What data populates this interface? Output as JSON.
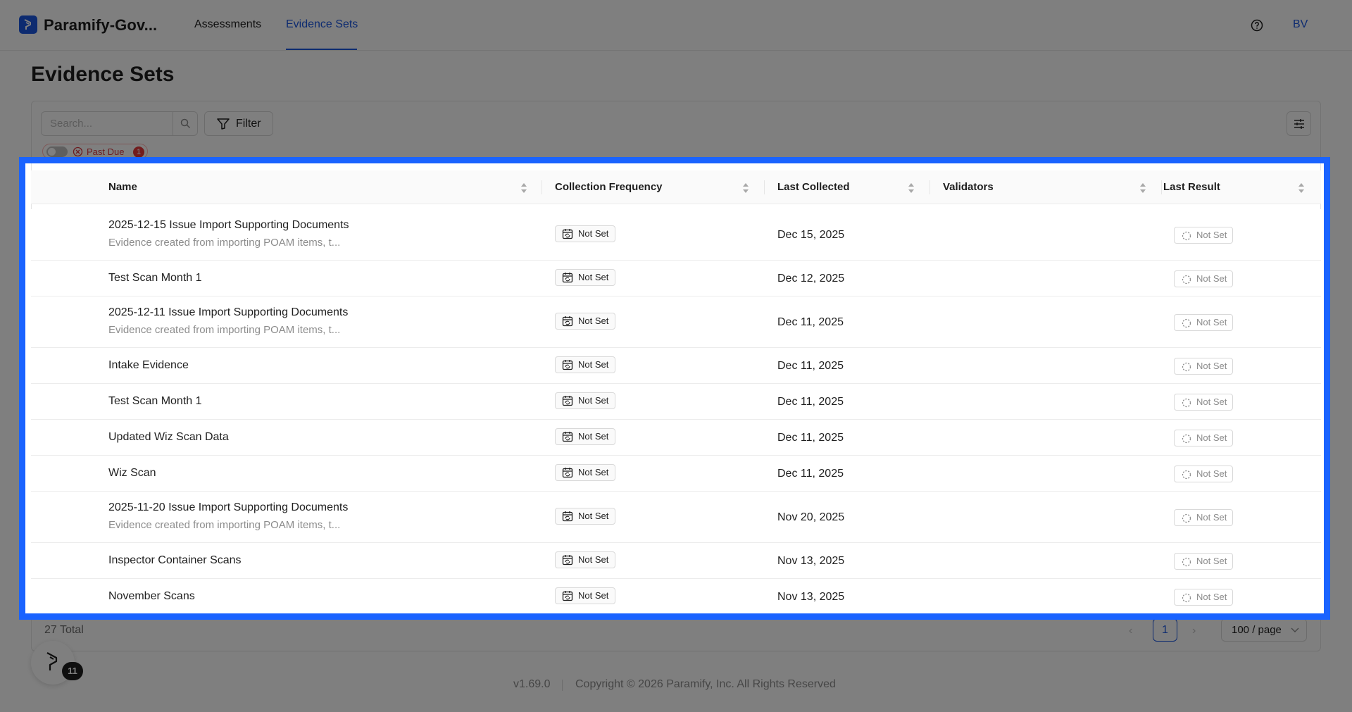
{
  "header": {
    "app_title": "Paramify-Gov...",
    "nav": [
      {
        "label": "Assessments"
      },
      {
        "label": "Evidence Sets"
      }
    ],
    "avatar": "BV"
  },
  "page": {
    "title": "Evidence Sets"
  },
  "toolbar": {
    "search_placeholder": "Search...",
    "filter_label": "Filter",
    "past_due_label": "Past Due",
    "past_due_count": "1"
  },
  "table": {
    "columns": [
      "Name",
      "Collection Frequency",
      "Last Collected",
      "Validators",
      "Last Result"
    ],
    "rows": [
      {
        "name": "2025-12-15 Issue Import Supporting Documents",
        "desc": "Evidence created from importing POAM items, t...",
        "freq": "Not Set",
        "date": "Dec 15, 2025",
        "result": "Not Set"
      },
      {
        "name": "Test Scan Month 1",
        "desc": "",
        "freq": "Not Set",
        "date": "Dec 12, 2025",
        "result": "Not Set"
      },
      {
        "name": "2025-12-11 Issue Import Supporting Documents",
        "desc": "Evidence created from importing POAM items, t...",
        "freq": "Not Set",
        "date": "Dec 11, 2025",
        "result": "Not Set"
      },
      {
        "name": "Intake Evidence",
        "desc": "",
        "freq": "Not Set",
        "date": "Dec 11, 2025",
        "result": "Not Set"
      },
      {
        "name": "Test Scan Month 1",
        "desc": "",
        "freq": "Not Set",
        "date": "Dec 11, 2025",
        "result": "Not Set"
      },
      {
        "name": "Updated Wiz Scan Data",
        "desc": "",
        "freq": "Not Set",
        "date": "Dec 11, 2025",
        "result": "Not Set"
      },
      {
        "name": "Wiz Scan",
        "desc": "",
        "freq": "Not Set",
        "date": "Dec 11, 2025",
        "result": "Not Set"
      },
      {
        "name": "2025-11-20 Issue Import Supporting Documents",
        "desc": "Evidence created from importing POAM items, t...",
        "freq": "Not Set",
        "date": "Nov 20, 2025",
        "result": "Not Set"
      },
      {
        "name": "Inspector Container Scans",
        "desc": "",
        "freq": "Not Set",
        "date": "Nov 13, 2025",
        "result": "Not Set"
      },
      {
        "name": "November Scans",
        "desc": "",
        "freq": "Not Set",
        "date": "Nov 13, 2025",
        "result": "Not Set"
      }
    ]
  },
  "pagination": {
    "total": "27 Total",
    "current_page": "1",
    "page_size": "100 / page"
  },
  "fab": {
    "badge": "11"
  },
  "footer": {
    "version": "v1.69.0",
    "copyright": "Copyright © 2026 Paramify, Inc. All Rights Reserved"
  },
  "colors": {
    "accent": "#1a56e0",
    "highlight": "#1a63ff",
    "danger": "#e5383b"
  },
  "icons": [
    "logo-icon",
    "help-icon",
    "search-icon",
    "filter-icon",
    "column-settings-icon",
    "sort-icon",
    "calendar-sync-icon",
    "dashed-circle-icon",
    "chevron-left-icon",
    "chevron-right-icon",
    "chevron-down-icon",
    "close-circle-icon"
  ]
}
